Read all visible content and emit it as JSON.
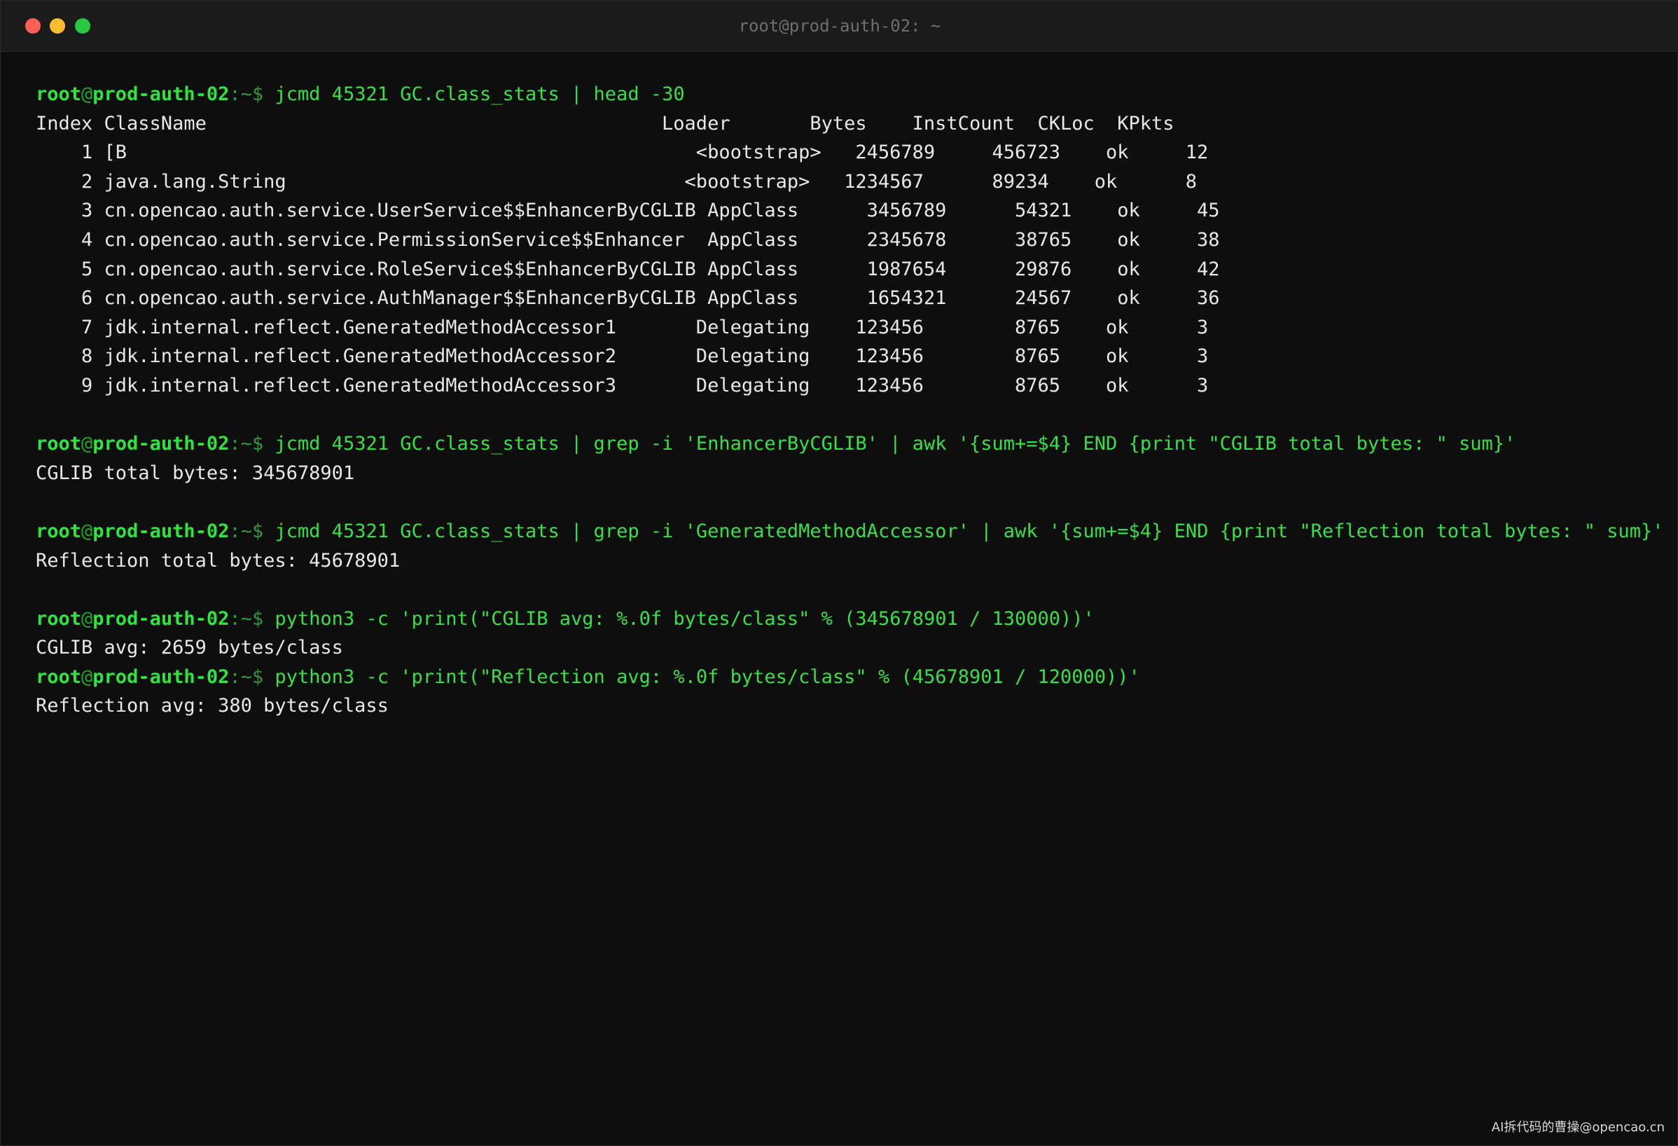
{
  "window": {
    "title": "root@prod-auth-02: ~"
  },
  "prompt": {
    "user": "root",
    "at": "@",
    "host": "prod-auth-02",
    "path": ":~$ "
  },
  "session": [
    {
      "command": "jcmd 45321 GC.class_stats | head -30",
      "output": [
        "Index ClassName                                        Loader       Bytes    InstCount  CKLoc  KPkts",
        "    1 [B                                                  <bootstrap>   2456789     456723    ok     12",
        "    2 java.lang.String                                   <bootstrap>   1234567      89234    ok      8",
        "    3 cn.opencao.auth.service.UserService$$EnhancerByCGLIB AppClass      3456789      54321    ok     45",
        "    4 cn.opencao.auth.service.PermissionService$$Enhancer  AppClass      2345678      38765    ok     38",
        "    5 cn.opencao.auth.service.RoleService$$EnhancerByCGLIB AppClass      1987654      29876    ok     42",
        "    6 cn.opencao.auth.service.AuthManager$$EnhancerByCGLIB AppClass      1654321      24567    ok     36",
        "    7 jdk.internal.reflect.GeneratedMethodAccessor1       Delegating    123456        8765    ok      3",
        "    8 jdk.internal.reflect.GeneratedMethodAccessor2       Delegating    123456        8765    ok      3",
        "    9 jdk.internal.reflect.GeneratedMethodAccessor3       Delegating    123456        8765    ok      3"
      ],
      "blank_after": true
    },
    {
      "command": "jcmd 45321 GC.class_stats | grep -i 'EnhancerByCGLIB' | awk '{sum+=$4} END {print \"CGLIB total bytes: \" sum}'",
      "output": [
        "CGLIB total bytes: 345678901"
      ],
      "blank_after": true
    },
    {
      "command": "jcmd 45321 GC.class_stats | grep -i 'GeneratedMethodAccessor' | awk '{sum+=$4} END {print \"Reflection total bytes: \" sum}'",
      "output": [
        "Reflection total bytes: 45678901"
      ],
      "blank_after": true
    },
    {
      "command": "python3 -c 'print(\"CGLIB avg: %.0f bytes/class\" % (345678901 / 130000))'",
      "output": [
        "CGLIB avg: 2659 bytes/class"
      ],
      "blank_after": false
    },
    {
      "command": "python3 -c 'print(\"Reflection avg: %.0f bytes/class\" % (45678901 / 120000))'",
      "output": [
        "Reflection avg: 380 bytes/class"
      ],
      "blank_after": false
    }
  ],
  "watermark": "AI拆代码的曹操@opencao.cn",
  "colors": {
    "background": "#0e0e0e",
    "prompt_green": "#2ee43e",
    "command_green": "#37e046",
    "output_text": "#e8e8e8",
    "close": "#ff5f57",
    "minimize": "#febc2e",
    "zoom": "#28c840"
  }
}
